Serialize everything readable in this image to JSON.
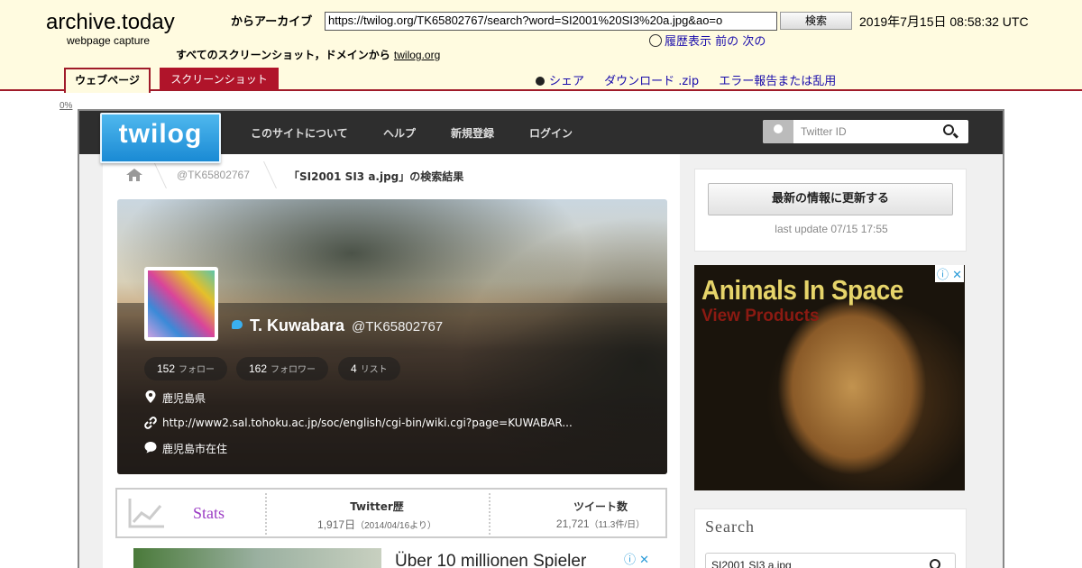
{
  "archive": {
    "title": "archive.today",
    "subtitle": "webpage capture",
    "from_label": "からアーカイブ",
    "url": "https://twilog.org/TK65802767/search?word=SI2001%20SI3%20a.jpg&ao=o",
    "search_button": "検索",
    "datetime": "2019年7月15日 08:58:32 UTC",
    "history": "履歴表示",
    "prev": "前の",
    "next": "次の",
    "all_screens_label": "すべてのスクリーンショット，ドメインから",
    "domain": "twilog.org",
    "tab_web": "ウェブページ",
    "tab_screenshot": "スクリーンショット",
    "share": "シェア",
    "download": "ダウンロード .zip",
    "report": "エラー報告または乱用",
    "percent": "0%"
  },
  "nav": {
    "logo": "twilog",
    "items": [
      "このサイトについて",
      "ヘルプ",
      "新規登録",
      "ログイン"
    ],
    "twitter_id_placeholder": "Twitter ID"
  },
  "breadcrumb": {
    "user": "@TK65802767",
    "current": "「SI2001 SI3 a.jpg」の検索結果"
  },
  "profile": {
    "name": "T. Kuwabara",
    "handle": "@TK65802767",
    "following": "152",
    "following_label": "フォロー",
    "followers": "162",
    "followers_label": "フォロワー",
    "lists": "4",
    "lists_label": "リスト",
    "location": "鹿児島県",
    "website": "http://www2.sal.tohoku.ac.jp/soc/english/cgi-bin/wiki.cgi?page=KUWABAR...",
    "bio": "鹿児島市在住"
  },
  "stats": {
    "label": "Stats",
    "history_heading": "Twitter歴",
    "history_value": "1,917日",
    "history_note": "（2014/04/16より）",
    "tweets_heading": "ツイート数",
    "tweets_value": "21,721",
    "tweets_note": "（11.3件/日）"
  },
  "ad_bottom": {
    "text": "Über 10 millionen Spieler"
  },
  "sidebar": {
    "update_button": "最新の情報に更新する",
    "last_update": "last update 07/15 17:55",
    "ad_title": "Animals In Space",
    "ad_sub": "View Products",
    "search_heading": "Search",
    "search_value": "SI2001 SI3 a.jpg"
  }
}
